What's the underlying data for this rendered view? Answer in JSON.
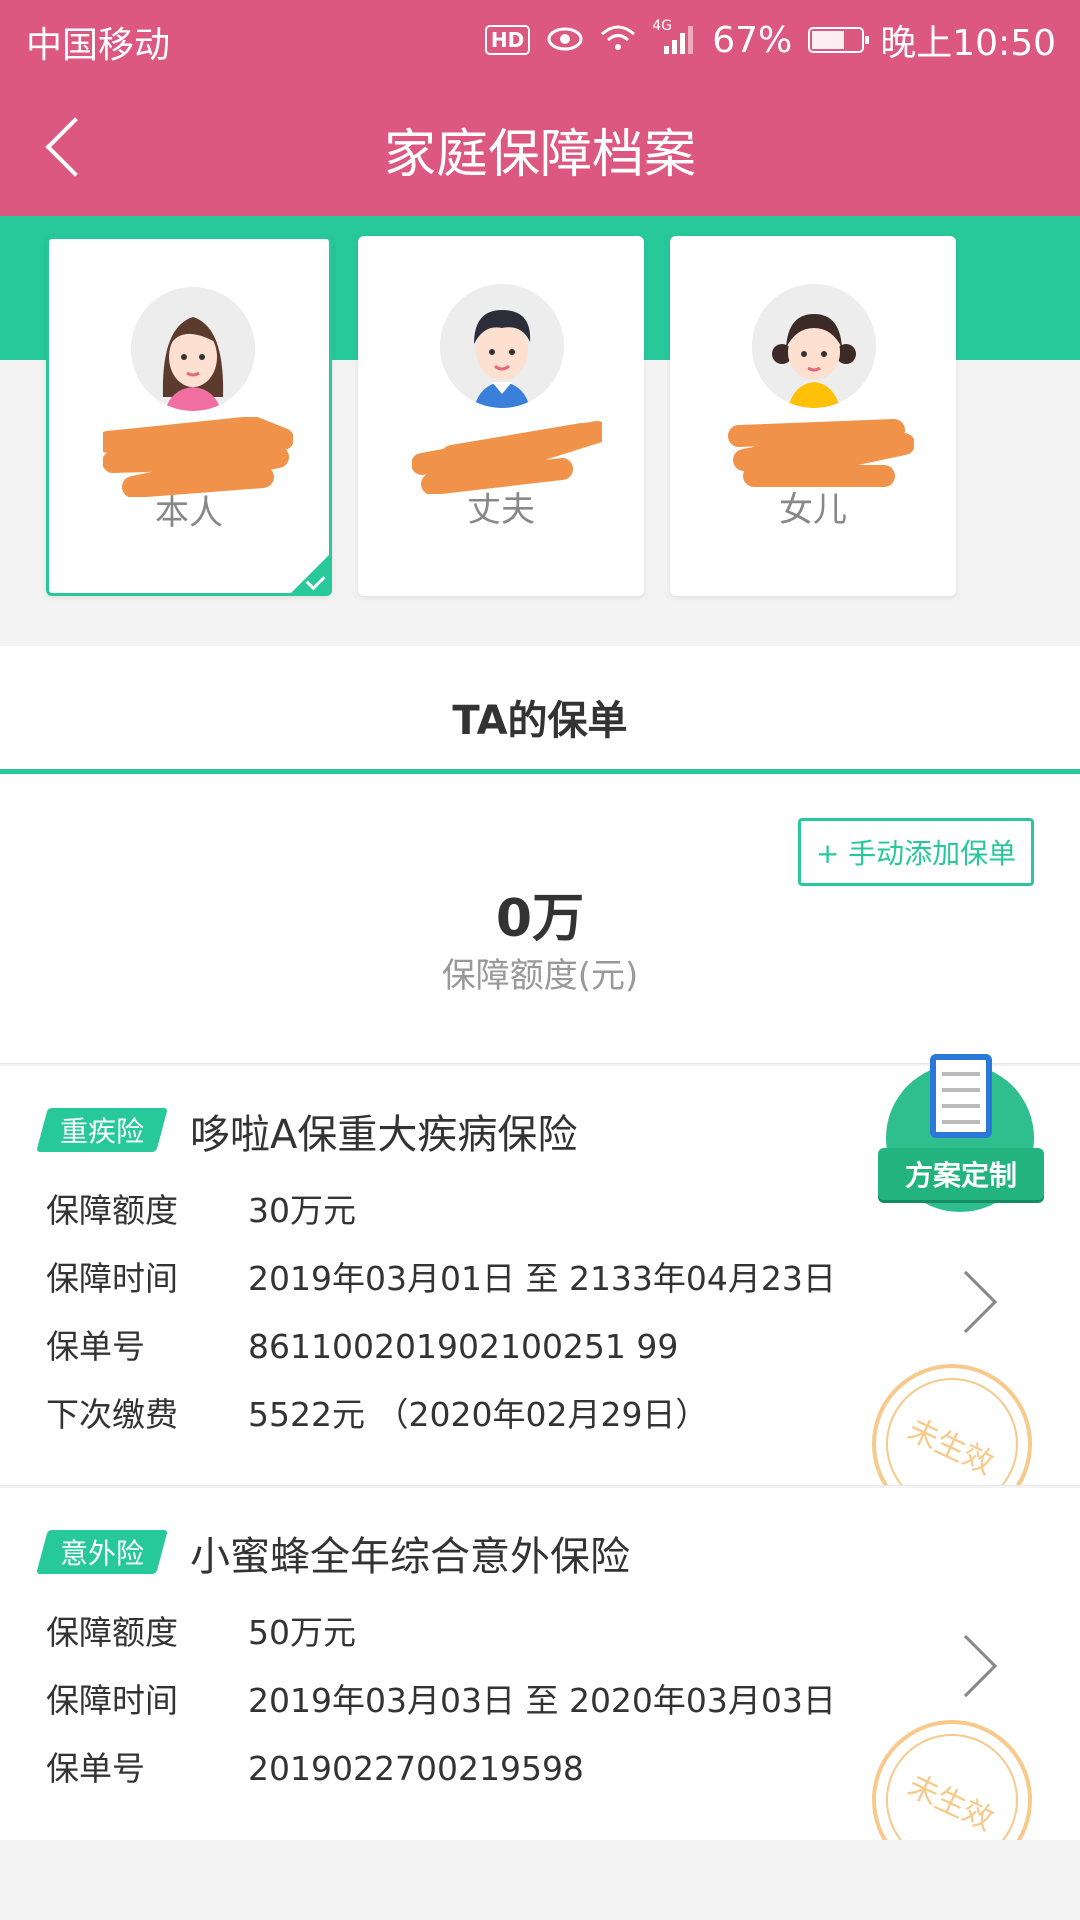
{
  "status_bar": {
    "carrier": "中国移动",
    "hd": "HD",
    "network": "4G",
    "battery": "67%",
    "battery_level": 0.67,
    "time": "晚上10:50"
  },
  "header": {
    "title": "家庭保障档案"
  },
  "members": [
    {
      "role": "本人",
      "selected": true
    },
    {
      "role": "丈夫",
      "selected": false
    },
    {
      "role": "女儿",
      "selected": false
    }
  ],
  "tab": {
    "label": "TA的保单"
  },
  "summary": {
    "add_button": "+ 手动添加保单",
    "amount": "0万",
    "amount_label": "保障额度(元)"
  },
  "fab": {
    "label": "方案定制"
  },
  "policies": [
    {
      "tag": "重疾险",
      "name": "哆啦A保重大疾病保险",
      "rows": [
        {
          "label": "保障额度",
          "value": "30万元"
        },
        {
          "label": "保障时间",
          "value": "2019年03月01日 至 2133年04月23日"
        },
        {
          "label": "保单号",
          "value": "861100201902100251 99"
        },
        {
          "label": "下次缴费",
          "value": "5522元 （2020年02月29日）"
        }
      ],
      "stamp": "未生效"
    },
    {
      "tag": "意外险",
      "name": "小蜜蜂全年综合意外保险",
      "rows": [
        {
          "label": "保障额度",
          "value": "50万元"
        },
        {
          "label": "保障时间",
          "value": "2019年03月03日 至 2020年03月03日"
        },
        {
          "label": "保单号",
          "value": "2019022700219598"
        }
      ],
      "stamp": "未生效"
    }
  ],
  "colors": {
    "header": "#dc5881",
    "accent": "#27c89a",
    "stamp": "#f7c98a"
  }
}
